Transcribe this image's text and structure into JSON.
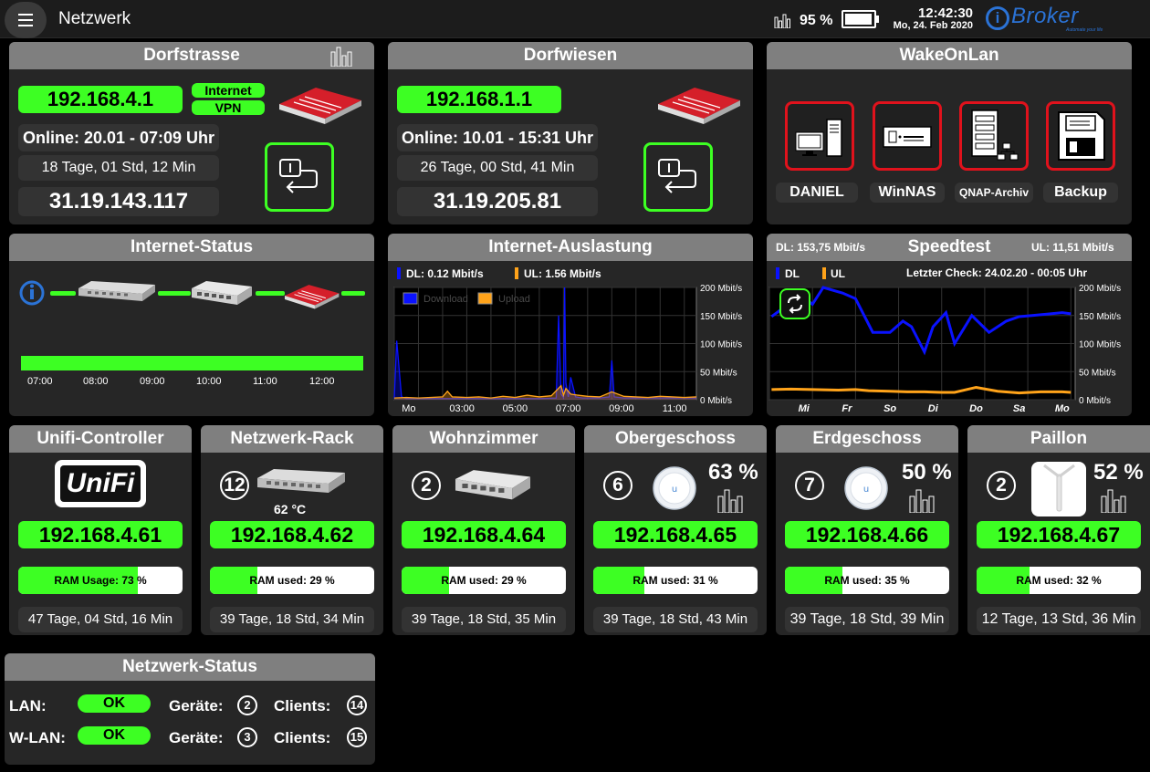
{
  "header": {
    "title": "Netzwerk",
    "battery_percent": "95 %",
    "battery_level": 0.95,
    "time": "12:42:30",
    "date": "Mo, 24. Feb 2020",
    "brand_i": "i",
    "brand": "Broker",
    "brand_tagline": "Automate your life"
  },
  "dorfstrasse": {
    "title": "Dorfstrasse",
    "ip": "192.168.4.1",
    "badge_internet": "Internet",
    "badge_vpn": "VPN",
    "online": "Online: 20.01 - 07:09 Uhr",
    "uptime": "18 Tage, 01 Std, 12 Min",
    "public_ip": "31.19.143.117"
  },
  "dorfwiesen": {
    "title": "Dorfwiesen",
    "ip": "192.168.1.1",
    "online": "Online: 10.01 - 15:31 Uhr",
    "uptime": "26 Tage, 00 Std, 41 Min",
    "public_ip": "31.19.205.81"
  },
  "wol": {
    "title": "WakeOnLan",
    "devices": [
      {
        "label": "DANIEL",
        "icon": "desktop-pc-icon"
      },
      {
        "label": "WinNAS",
        "icon": "nas-icon"
      },
      {
        "label": "QNAP-Archiv",
        "icon": "server-network-icon"
      },
      {
        "label": "Backup",
        "icon": "floppy-disk-icon"
      }
    ]
  },
  "inet_status": {
    "title": "Internet-Status",
    "times": [
      "07:00",
      "08:00",
      "09:00",
      "10:00",
      "11:00",
      "12:00"
    ]
  },
  "auslastung": {
    "title": "Internet-Auslastung",
    "dl_label": "DL: 0.12 Mbit/s",
    "ul_label": "UL: 1.56 Mbit/s",
    "legend_download": "Download",
    "legend_upload": "Upload"
  },
  "speedtest": {
    "title": "Speedtest",
    "dl": "DL: 153,75 Mbit/s",
    "ul": "UL: 11,51 Mbit/s",
    "legend_dl": "DL",
    "legend_ul": "UL",
    "last_check": "Letzter Check: 24.02.20 - 00:05 Uhr"
  },
  "devices": [
    {
      "title": "Unifi-Controller",
      "logo": "UniFi",
      "ip": "192.168.4.61",
      "ram_label": "RAM Usage: 73 %",
      "ram_pct": 73,
      "uptime": "47 Tage, 04 Std, 16 Min"
    },
    {
      "title": "Netzwerk-Rack",
      "count": "12",
      "temp": "62 °C",
      "ip": "192.168.4.62",
      "ram_label": "RAM used: 29 %",
      "ram_pct": 29,
      "uptime": "39 Tage, 18 Std, 34 Min"
    },
    {
      "title": "Wohnzimmer",
      "count": "2",
      "ip": "192.168.4.64",
      "ram_label": "RAM used: 29 %",
      "ram_pct": 29,
      "uptime": "39 Tage, 18 Std, 35 Min"
    },
    {
      "title": "Obergeschoss",
      "count": "6",
      "pct": "63 %",
      "ip": "192.168.4.65",
      "ram_label": "RAM used: 31 %",
      "ram_pct": 31,
      "uptime": "39 Tage, 18 Std, 43 Min"
    },
    {
      "title": "Erdgeschoss",
      "count": "7",
      "pct": "50 %",
      "ip": "192.168.4.66",
      "ram_label": "RAM used: 35 %",
      "ram_pct": 35,
      "uptime": "39 Tage, 18 Std, 39 Min"
    },
    {
      "title": "Paillon",
      "count": "2",
      "pct": "52 %",
      "ip": "192.168.4.67",
      "ram_label": "RAM used: 32 %",
      "ram_pct": 32,
      "uptime": "12 Tage, 13 Std, 36 Min"
    }
  ],
  "netstatus": {
    "title": "Netzwerk-Status",
    "lan_label": "LAN:",
    "lan_status": "OK",
    "wlan_label": "W-LAN:",
    "wlan_status": "OK",
    "geraete_label": "Geräte:",
    "clients_label": "Clients:",
    "lan_geraete": "2",
    "lan_clients": "14",
    "wlan_geraete": "3",
    "wlan_clients": "15"
  },
  "colors": {
    "accent_green": "#3dff23",
    "header_gray": "#7f7f7f",
    "tile_bg": "#262626",
    "download_blue": "#0a12ff",
    "upload_orange": "#ffa31a",
    "wol_red": "#e0121c"
  },
  "chart_data": [
    {
      "type": "area",
      "title": "Internet-Auslastung",
      "x_ticks": [
        "Mo",
        "03:00",
        "05:00",
        "07:00",
        "09:00",
        "11:00"
      ],
      "y_ticks": [
        "200 Mbit/s",
        "150 Mbit/s",
        "100 Mbit/s",
        "50 Mbit/s",
        "0 Mbit/s"
      ],
      "ylim": [
        0,
        200
      ],
      "legend": "top-left",
      "grid": true,
      "series": [
        {
          "name": "Download",
          "color": "#0a12ff",
          "x": [
            0,
            0.1,
            0.3,
            0.5,
            1,
            2,
            3,
            4,
            5,
            6,
            6.7,
            6.8,
            6.9,
            7,
            7.05,
            7.1,
            7.2,
            7.3,
            7.5,
            7.8,
            8,
            8.5,
            8.9,
            9,
            9.1,
            9.5,
            10,
            11,
            12,
            12.5
          ],
          "y": [
            2,
            105,
            5,
            2,
            2,
            2,
            2,
            2,
            2,
            2,
            3,
            150,
            10,
            4,
            200,
            30,
            5,
            40,
            5,
            3,
            3,
            3,
            5,
            70,
            5,
            3,
            3,
            3,
            3,
            3
          ]
        },
        {
          "name": "Upload",
          "color": "#ffa31a",
          "x": [
            0,
            0.5,
            1,
            1.5,
            2,
            2.2,
            2.4,
            3,
            3.5,
            4,
            4.5,
            5,
            5.5,
            6,
            6.5,
            6.9,
            7,
            7.1,
            7.3,
            7.6,
            8,
            8.5,
            9,
            9.5,
            10,
            10.5,
            11,
            11.5,
            12,
            12.5
          ],
          "y": [
            3,
            4,
            3,
            4,
            5,
            15,
            5,
            4,
            5,
            3,
            6,
            4,
            8,
            5,
            7,
            25,
            8,
            20,
            10,
            8,
            6,
            5,
            14,
            6,
            5,
            4,
            6,
            5,
            4,
            5
          ]
        }
      ]
    },
    {
      "type": "line",
      "title": "Speedtest",
      "categories": [
        "Mi",
        "Fr",
        "So",
        "Di",
        "Do",
        "Sa",
        "Mo"
      ],
      "y_ticks": [
        "200 Mbit/s",
        "150 Mbit/s",
        "100 Mbit/s",
        "50 Mbit/s",
        "0 Mbit/s"
      ],
      "ylim": [
        0,
        200
      ],
      "legend": "top-left",
      "grid": true,
      "series": [
        {
          "name": "DL",
          "color": "#0a12ff",
          "x": [
            -0.75,
            -0.45,
            -0.05,
            0.2,
            0.45,
            0.9,
            1.2,
            1.6,
            2.0,
            2.3,
            2.5,
            2.8,
            3.0,
            3.3,
            3.5,
            3.9,
            4.3,
            4.6,
            4.7,
            5.0,
            5.3,
            6.0,
            6.2
          ],
          "y": [
            148,
            165,
            185,
            170,
            200,
            190,
            180,
            120,
            120,
            140,
            130,
            85,
            130,
            155,
            100,
            150,
            120,
            135,
            140,
            148,
            150,
            155,
            153
          ]
        },
        {
          "name": "UL",
          "color": "#ffa31a",
          "x": [
            -0.75,
            -0.3,
            0.2,
            0.8,
            1.2,
            1.5,
            2.0,
            2.4,
            2.8,
            3.2,
            3.5,
            4.0,
            4.5,
            5.0,
            5.5,
            6.0,
            6.2
          ],
          "y": [
            18,
            19,
            18,
            17,
            18,
            16,
            15,
            14,
            14,
            13,
            13,
            22,
            15,
            12,
            14,
            14,
            13
          ]
        }
      ]
    }
  ]
}
